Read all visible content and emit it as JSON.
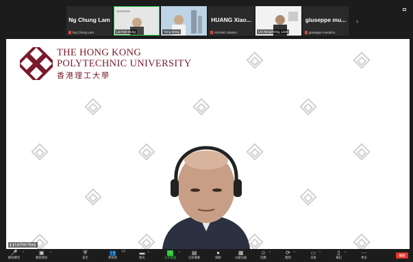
{
  "gallery": {
    "tiles": [
      {
        "kind": "name",
        "big": "Ng Chung Lam",
        "small": "Ng Chung Lam",
        "muted": true
      },
      {
        "kind": "video",
        "label": "Lai Kee Hung",
        "active": true
      },
      {
        "kind": "video",
        "label": "Yang Dong",
        "active": false
      },
      {
        "kind": "name",
        "big": "HUANG Xiao...",
        "small": "HUANG Xiaoxin",
        "muted": true
      },
      {
        "kind": "video",
        "label": "LIU Mingzheng, Liam",
        "active": false
      },
      {
        "kind": "name",
        "big": "giuseppe mu...",
        "small": "giuseppe musolino",
        "muted": true
      }
    ],
    "next_label": "›",
    "view_label": ""
  },
  "share": {
    "logo_line1": "The Hong Kong",
    "logo_line2": "Polytechnic University",
    "logo_line3": "香港理工大學",
    "speaker_label": "Lai Kee Hung"
  },
  "toolbar": {
    "items": [
      {
        "name": "mute",
        "icon": "🎤",
        "label": "解除靜音",
        "caret": true
      },
      {
        "name": "video",
        "icon": "▣",
        "label": "開始視訊",
        "caret": true
      },
      {
        "name": "security",
        "icon": "⛨",
        "label": "安全",
        "caret": false
      },
      {
        "name": "participants",
        "icon": "👥",
        "label": "參與者",
        "caret": true,
        "count": "14"
      },
      {
        "name": "chat",
        "icon": "▬",
        "label": "聊天",
        "caret": true
      },
      {
        "name": "share-screen",
        "icon": "↑",
        "label": "分享畫面",
        "caret": true
      },
      {
        "name": "summary",
        "icon": "▤",
        "label": "已有摘要",
        "caret": false
      },
      {
        "name": "record",
        "icon": "●",
        "label": "錄製",
        "caret": false
      },
      {
        "name": "breakout",
        "icon": "▦",
        "label": "分組討論",
        "caret": false
      },
      {
        "name": "reactions",
        "icon": "☺",
        "label": "回應",
        "caret": true
      },
      {
        "name": "apps",
        "icon": "⟳",
        "label": "應用",
        "caret": true
      },
      {
        "name": "whiteboard",
        "icon": "▭",
        "label": "白板",
        "caret": true
      },
      {
        "name": "notes",
        "icon": "▯",
        "label": "筆記",
        "caret": true
      },
      {
        "name": "more",
        "icon": "⋯",
        "label": "更多",
        "caret": false
      }
    ],
    "end_label": "離開"
  },
  "colors": {
    "accent_green": "#2ecc40",
    "end_red": "#e0352b",
    "polyu_maroon": "#7a1a2c"
  }
}
